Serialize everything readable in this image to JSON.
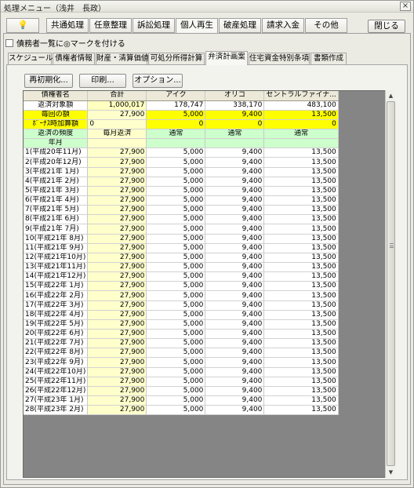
{
  "window": {
    "title": "処理メニュー（浅井　長政）",
    "close_glyph": "×"
  },
  "tabs": [
    "💡",
    "共通処理",
    "任意整理",
    "訴訟処理",
    "個人再生",
    "破産処理",
    "請求入金",
    "その他"
  ],
  "tabs_active": 4,
  "close_button": "閉じる",
  "checkbox_label": "債務者一覧に◎マークを付ける",
  "subtabs": [
    "スケジュール",
    "債権者情報",
    "財産・清算価値",
    "可処分所得計算",
    "弁済計画案",
    "住宅資金特別条項",
    "書類作成"
  ],
  "subtabs_active": 4,
  "buttons": {
    "reset": "再初期化...",
    "print": "印刷...",
    "options": "オプション..."
  },
  "grid": {
    "header": [
      "債権者名",
      "合計",
      "アイク",
      "オリコ",
      "セントラルファイナ..."
    ],
    "target_row": [
      "返済対象額",
      "1,000,017",
      "178,747",
      "338,170",
      "483,100"
    ],
    "each_row": [
      "毎回の額",
      "27,900",
      "5,000",
      "9,400",
      "13,500"
    ],
    "bonus_row": [
      "ﾎﾞｰﾅｽ時加算額",
      "0",
      "0",
      "0",
      "0"
    ],
    "freq_row": [
      "返済の頻度",
      "毎月返済",
      "通常",
      "通常",
      "通常"
    ],
    "year_label": "年月",
    "rows": [
      [
        "1(平成20年11月)",
        "27,900",
        "5,000",
        "9,400",
        "13,500"
      ],
      [
        "2(平成20年12月)",
        "27,900",
        "5,000",
        "9,400",
        "13,500"
      ],
      [
        "3(平成21年 1月)",
        "27,900",
        "5,000",
        "9,400",
        "13,500"
      ],
      [
        "4(平成21年 2月)",
        "27,900",
        "5,000",
        "9,400",
        "13,500"
      ],
      [
        "5(平成21年 3月)",
        "27,900",
        "5,000",
        "9,400",
        "13,500"
      ],
      [
        "6(平成21年 4月)",
        "27,900",
        "5,000",
        "9,400",
        "13,500"
      ],
      [
        "7(平成21年 5月)",
        "27,900",
        "5,000",
        "9,400",
        "13,500"
      ],
      [
        "8(平成21年 6月)",
        "27,900",
        "5,000",
        "9,400",
        "13,500"
      ],
      [
        "9(平成21年 7月)",
        "27,900",
        "5,000",
        "9,400",
        "13,500"
      ],
      [
        "10(平成21年 8月)",
        "27,900",
        "5,000",
        "9,400",
        "13,500"
      ],
      [
        "11(平成21年 9月)",
        "27,900",
        "5,000",
        "9,400",
        "13,500"
      ],
      [
        "12(平成21年10月)",
        "27,900",
        "5,000",
        "9,400",
        "13,500"
      ],
      [
        "13(平成21年11月)",
        "27,900",
        "5,000",
        "9,400",
        "13,500"
      ],
      [
        "14(平成21年12月)",
        "27,900",
        "5,000",
        "9,400",
        "13,500"
      ],
      [
        "15(平成22年 1月)",
        "27,900",
        "5,000",
        "9,400",
        "13,500"
      ],
      [
        "16(平成22年 2月)",
        "27,900",
        "5,000",
        "9,400",
        "13,500"
      ],
      [
        "17(平成22年 3月)",
        "27,900",
        "5,000",
        "9,400",
        "13,500"
      ],
      [
        "18(平成22年 4月)",
        "27,900",
        "5,000",
        "9,400",
        "13,500"
      ],
      [
        "19(平成22年 5月)",
        "27,900",
        "5,000",
        "9,400",
        "13,500"
      ],
      [
        "20(平成22年 6月)",
        "27,900",
        "5,000",
        "9,400",
        "13,500"
      ],
      [
        "21(平成22年 7月)",
        "27,900",
        "5,000",
        "9,400",
        "13,500"
      ],
      [
        "22(平成22年 8月)",
        "27,900",
        "5,000",
        "9,400",
        "13,500"
      ],
      [
        "23(平成22年 9月)",
        "27,900",
        "5,000",
        "9,400",
        "13,500"
      ],
      [
        "24(平成22年10月)",
        "27,900",
        "5,000",
        "9,400",
        "13,500"
      ],
      [
        "25(平成22年11月)",
        "27,900",
        "5,000",
        "9,400",
        "13,500"
      ],
      [
        "26(平成22年12月)",
        "27,900",
        "5,000",
        "9,400",
        "13,500"
      ],
      [
        "27(平成23年 1月)",
        "27,900",
        "5,000",
        "9,400",
        "13,500"
      ],
      [
        "28(平成23年 2月)",
        "27,900",
        "5,000",
        "9,400",
        "13,500"
      ]
    ]
  }
}
